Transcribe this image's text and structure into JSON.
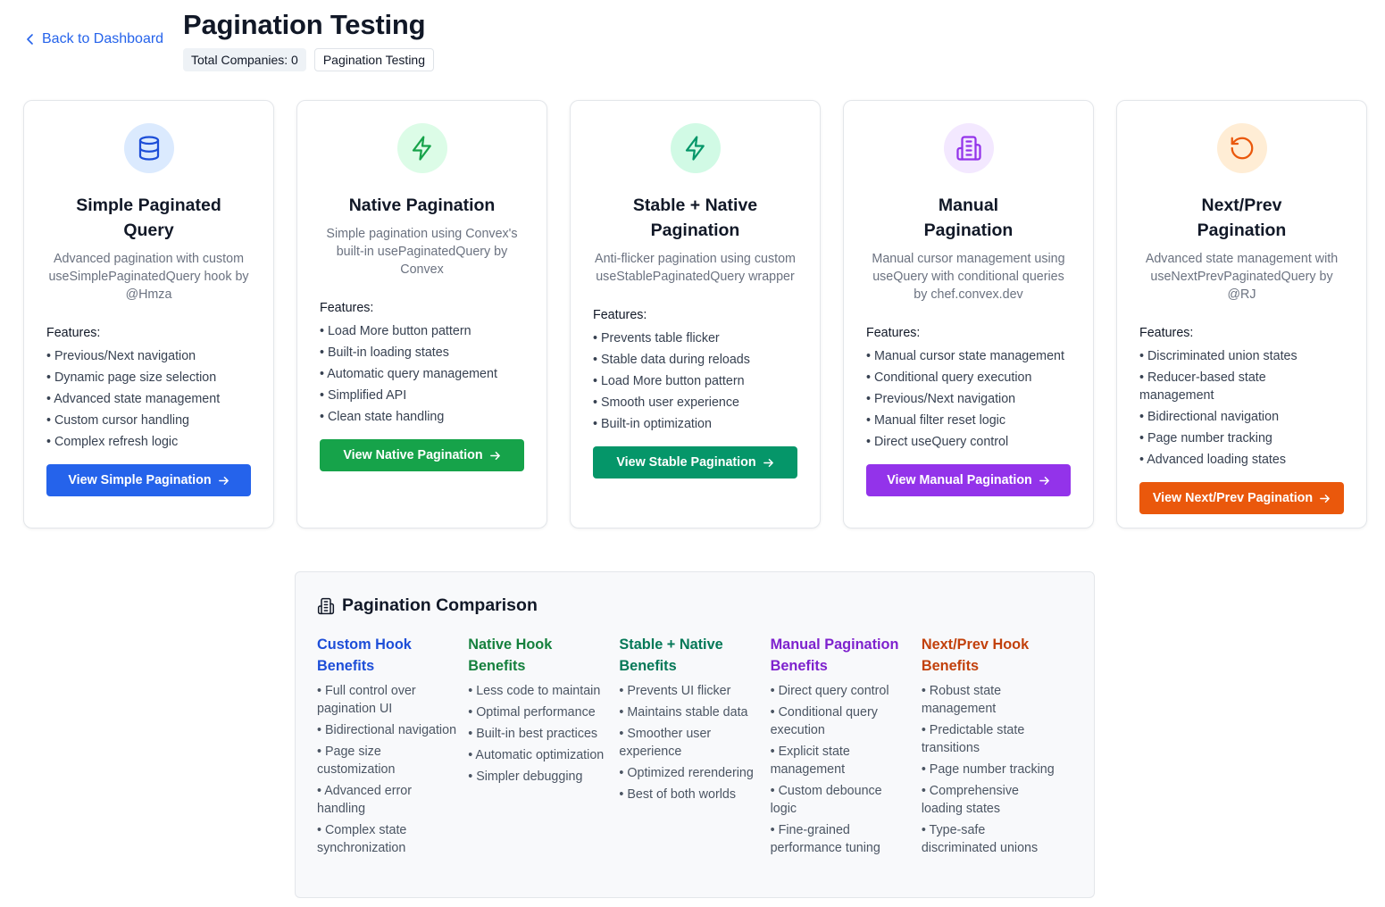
{
  "header": {
    "back_label": "Back to Dashboard",
    "title": "Pagination Testing",
    "badges": [
      "Total Companies: 0",
      "Pagination Testing"
    ]
  },
  "cards": [
    {
      "icon": "database-icon",
      "accent": "#1d4ed8",
      "icon_bg": "#dbeafe",
      "title": "Simple Paginated Query",
      "description": "Advanced pagination with custom useSimplePaginatedQuery hook by @Hmza",
      "features_label": "Features:",
      "features": [
        "Previous/Next navigation",
        "Dynamic page size selection",
        "Advanced state management",
        "Custom cursor handling",
        "Complex refresh logic"
      ],
      "button_label": "View Simple Pagination",
      "button_color": "#2563eb"
    },
    {
      "icon": "zap-icon",
      "accent": "#16a34a",
      "icon_bg": "#dcfce7",
      "title": "Native Pagination",
      "description": "Simple pagination using Convex's built-in usePaginatedQuery by Convex",
      "features_label": "Features:",
      "features": [
        "Load More button pattern",
        "Built-in loading states",
        "Automatic query management",
        "Simplified API",
        "Clean state handling"
      ],
      "button_label": "View Native Pagination",
      "button_color": "#16a34a"
    },
    {
      "icon": "zap-icon",
      "accent": "#059669",
      "icon_bg": "#d1fae5",
      "title": "Stable + Native Pagination",
      "description": "Anti-flicker pagination using custom useStablePaginatedQuery wrapper",
      "features_label": "Features:",
      "features": [
        "Prevents table flicker",
        "Stable data during reloads",
        "Load More button pattern",
        "Smooth user experience",
        "Built-in optimization"
      ],
      "button_label": "View Stable Pagination",
      "button_color": "#059669"
    },
    {
      "icon": "building-icon",
      "accent": "#9333ea",
      "icon_bg": "#f3e8ff",
      "title": "Manual Pagination",
      "description": "Manual cursor management using useQuery with conditional queries by chef.convex.dev",
      "features_label": "Features:",
      "features": [
        "Manual cursor state management",
        "Conditional query execution",
        "Previous/Next navigation",
        "Manual filter reset logic",
        "Direct useQuery control"
      ],
      "button_label": "View Manual Pagination",
      "button_color": "#9333ea"
    },
    {
      "icon": "rotate-ccw-icon",
      "accent": "#ea580c",
      "icon_bg": "#ffedd5",
      "title": "Next/Prev Pagination",
      "description": "Advanced state management with useNextPrevPaginatedQuery by @RJ",
      "features_label": "Features:",
      "features": [
        "Discriminated union states",
        "Reducer-based state management",
        "Bidirectional navigation",
        "Page number tracking",
        "Advanced loading states"
      ],
      "button_label": "View Next/Prev Pagination",
      "button_color": "#ea580c"
    }
  ],
  "comparison": {
    "title": "Pagination Comparison",
    "columns": [
      {
        "title": "Custom Hook Benefits",
        "color": "#1d4ed8",
        "items": [
          "Full control over pagination UI",
          "Bidirectional navigation",
          "Page size customization",
          "Advanced error handling",
          "Complex state synchronization"
        ]
      },
      {
        "title": "Native Hook Benefits",
        "color": "#15803d",
        "items": [
          "Less code to maintain",
          "Optimal performance",
          "Built-in best practices",
          "Automatic optimization",
          "Simpler debugging"
        ]
      },
      {
        "title": "Stable + Native Benefits",
        "color": "#047857",
        "items": [
          "Prevents UI flicker",
          "Maintains stable data",
          "Smoother user experience",
          "Optimized rerendering",
          "Best of both worlds"
        ]
      },
      {
        "title": "Manual Pagination Benefits",
        "color": "#7e22ce",
        "items": [
          "Direct query control",
          "Conditional query execution",
          "Explicit state management",
          "Custom debounce logic",
          "Fine-grained performance tuning"
        ]
      },
      {
        "title": "Next/Prev Hook Benefits",
        "color": "#c2410c",
        "items": [
          "Robust state management",
          "Predictable state transitions",
          "Page number tracking",
          "Comprehensive loading states",
          "Type-safe discriminated unions"
        ]
      }
    ]
  }
}
